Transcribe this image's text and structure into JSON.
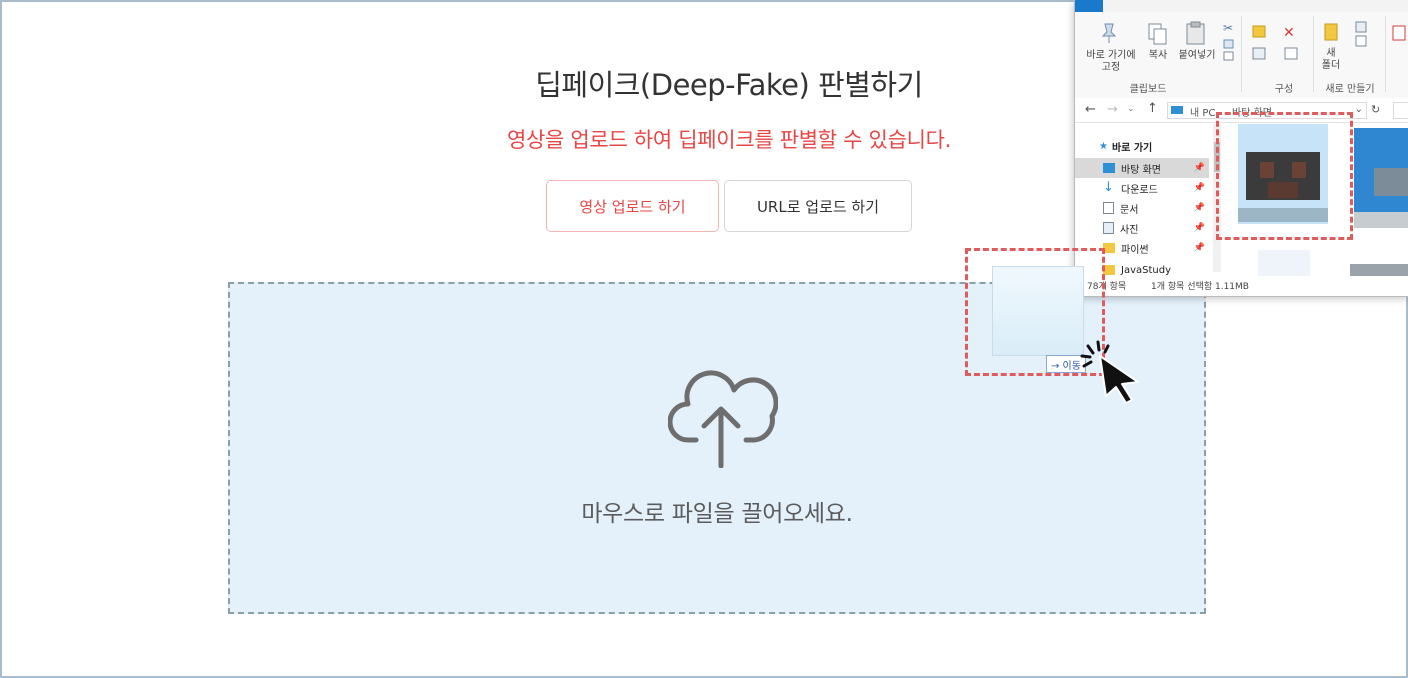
{
  "page": {
    "title": "딥페이크(Deep-Fake) 판별하기",
    "subtitle": "영상을 업로드 하여 딥페이크를 판별할 수 있습니다.",
    "buttons": {
      "video_upload": "영상 업로드 하기",
      "url_upload": "URL로 업로드 하기"
    },
    "dropzone": {
      "text": "마우스로 파일을 끌어오세요.",
      "icon": "cloud-upload-icon"
    },
    "drag": {
      "label": "→ 이동"
    }
  },
  "explorer": {
    "ribbon": {
      "pin_label_1": "바로 가기에",
      "pin_label_2": "고정",
      "copy_label": "복사",
      "paste_label": "붙여넣기",
      "new_label_1": "새",
      "new_label_2": "폴더",
      "groups": {
        "clipboard": "클립보드",
        "organize": "구성",
        "new": "새로 만들기"
      }
    },
    "address": {
      "path_1": "내 PC",
      "path_2": "바탕 화면"
    },
    "nav": {
      "quick": "바로 가기",
      "items": [
        "바탕 화면",
        "다운로드",
        "문서",
        "사진",
        "파이썬",
        "JavaStudy"
      ]
    },
    "status": {
      "count": "78개 항목",
      "selected": "1개 항목 선택함 1.11MB"
    }
  },
  "colors": {
    "accent": "#e84545",
    "dropzone_bg": "#e4f1fb",
    "highlight": "#e05b5b"
  }
}
